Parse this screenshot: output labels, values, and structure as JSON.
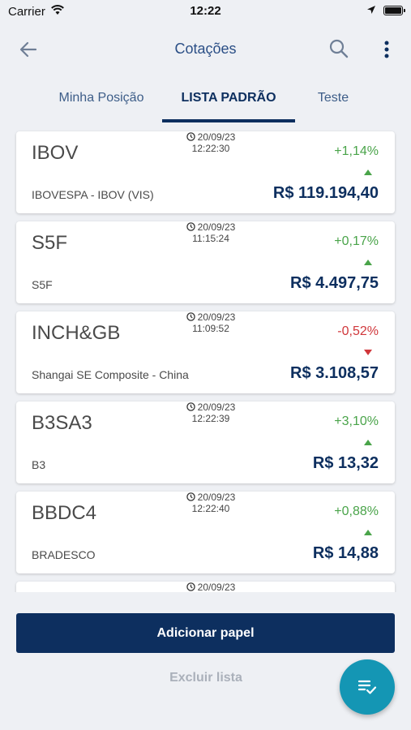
{
  "status_bar": {
    "carrier": "Carrier",
    "time": "12:22"
  },
  "header": {
    "title": "Cotações"
  },
  "tabs": [
    {
      "label": "Minha Posição",
      "active": false
    },
    {
      "label": "LISTA PADRÃO",
      "active": true
    },
    {
      "label": "Teste",
      "active": false
    }
  ],
  "quotes": [
    {
      "ticker": "IBOV",
      "name": "IBOVESPA - IBOV (VIS)",
      "date": "20/09/23",
      "time": "12:22:30",
      "change": "+1,14%",
      "direction": "up",
      "price": "R$ 119.194,40"
    },
    {
      "ticker": "S5F",
      "name": "S5F",
      "date": "20/09/23",
      "time": "11:15:24",
      "change": "+0,17%",
      "direction": "up",
      "price": "R$ 4.497,75"
    },
    {
      "ticker": "INCH&GB",
      "name": "Shangai SE Composite - China",
      "date": "20/09/23",
      "time": "11:09:52",
      "change": "-0,52%",
      "direction": "down",
      "price": "R$ 3.108,57"
    },
    {
      "ticker": "B3SA3",
      "name": "B3",
      "date": "20/09/23",
      "time": "12:22:39",
      "change": "+3,10%",
      "direction": "up",
      "price": "R$ 13,32"
    },
    {
      "ticker": "BBDC4",
      "name": "BRADESCO",
      "date": "20/09/23",
      "time": "12:22:40",
      "change": "+0,88%",
      "direction": "up",
      "price": "R$ 14,88"
    },
    {
      "date": "20/09/23"
    }
  ],
  "actions": {
    "add_label": "Adicionar papel",
    "delete_label": "Excluir lista"
  },
  "colors": {
    "primary": "#0d2f5f",
    "positive": "#4aa44a",
    "negative": "#d0373b",
    "fab": "#1496b4",
    "background": "#eef0f4"
  },
  "icons": {
    "back": "arrow-left-icon",
    "search": "search-icon",
    "more": "more-vertical-icon",
    "clock": "clock-icon",
    "fab": "playlist-check-icon"
  }
}
